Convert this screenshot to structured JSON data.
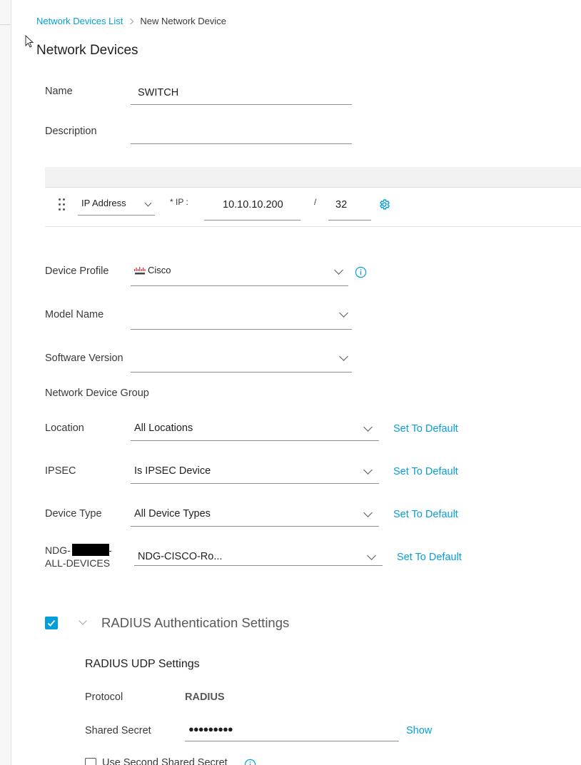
{
  "breadcrumb": {
    "parent": "Network Devices List",
    "current": "New Network Device"
  },
  "page": {
    "title": "Network Devices"
  },
  "form": {
    "name": {
      "label": "Name",
      "value": "SWITCH"
    },
    "description": {
      "label": "Description",
      "value": ""
    },
    "ip": {
      "type_value": "IP Address",
      "ip_label": "* IP :",
      "ip_value": "10.10.10.200",
      "slash": "/",
      "mask_value": "32"
    },
    "device_profile": {
      "label": "Device Profile",
      "value": "Cisco"
    },
    "model_name": {
      "label": "Model Name",
      "value": ""
    },
    "software_version": {
      "label": "Software Version",
      "value": ""
    },
    "ndg_heading": "Network Device Group",
    "location": {
      "label": "Location",
      "value": "All Locations",
      "default_link": "Set To Default"
    },
    "ipsec": {
      "label": "IPSEC",
      "value": "Is IPSEC Device",
      "default_link": "Set To Default"
    },
    "device_type": {
      "label": "Device Type",
      "value": "All Device Types",
      "default_link": "Set To Default"
    },
    "ndg_custom": {
      "label_line1": "NDG-",
      "label_line1_suffix": "-",
      "label_line2": "ALL-DEVICES",
      "value": "NDG-CISCO-Ro...",
      "default_link": "Set To Default"
    }
  },
  "radius": {
    "section_title": "RADIUS Authentication Settings",
    "udp_title": "RADIUS UDP Settings",
    "protocol_label": "Protocol",
    "protocol_value": "RADIUS",
    "secret_label": "Shared Secret",
    "secret_value": "●●●●●●●●●",
    "show_link": "Show",
    "second_secret_label": "Use Second Shared Secret"
  },
  "colors": {
    "accent": "#049fd9",
    "text": "#39393b"
  }
}
